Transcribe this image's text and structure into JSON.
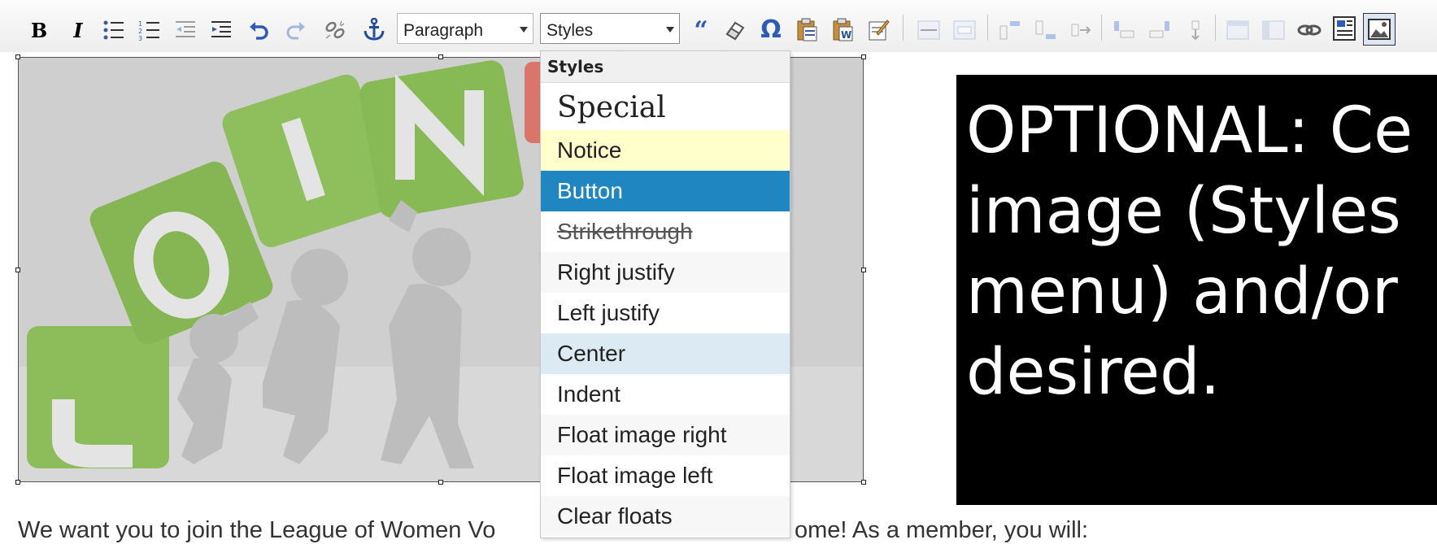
{
  "toolbar": {
    "format_select": {
      "value": "Paragraph"
    },
    "styles_select": {
      "value": "Styles"
    }
  },
  "styles_menu": {
    "header": "Styles",
    "items": [
      {
        "label": "Special",
        "style": "special"
      },
      {
        "label": "Notice",
        "style": "notice",
        "color": "#ffffcc"
      },
      {
        "label": "Button",
        "style": "button",
        "color": "#1f86c1"
      },
      {
        "label": "Strikethrough",
        "style": "strikethrough"
      },
      {
        "label": "Right justify",
        "style": "plain"
      },
      {
        "label": "Left justify",
        "style": "plain"
      },
      {
        "label": "Center",
        "style": "highlighted",
        "color": "#dbeaf3"
      },
      {
        "label": "Indent",
        "style": "plain"
      },
      {
        "label": "Float image right",
        "style": "plain"
      },
      {
        "label": "Float image left",
        "style": "plain"
      },
      {
        "label": "Clear floats",
        "style": "plain"
      }
    ]
  },
  "content": {
    "image_letters": [
      "J",
      "O",
      "I",
      "N"
    ],
    "black_box_text": "OPTIONAL: Ce\nimage (Styles\nmenu) and/or\ndesired.",
    "body_text_start": "We want you to join the League of Women Vo",
    "body_text_end": "ome! As a member, you will:"
  }
}
